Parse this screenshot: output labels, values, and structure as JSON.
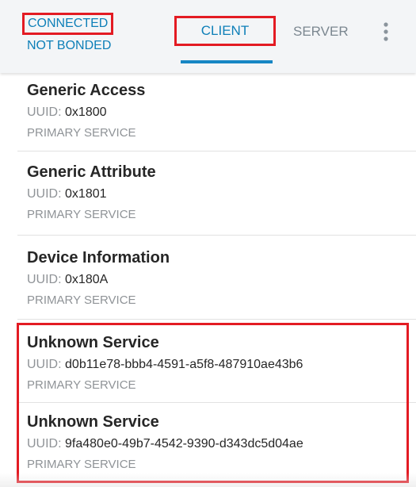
{
  "header": {
    "connection_status": "CONNECTED",
    "bond_status": "NOT BONDED",
    "tabs": [
      {
        "label": "CLIENT",
        "active": true
      },
      {
        "label": "SERVER",
        "active": false
      }
    ],
    "menu_icon": "overflow-vertical-dots-icon"
  },
  "services": [
    {
      "name": "Generic Access",
      "uuid_label": "UUID:",
      "uuid": "0x1800",
      "type": "PRIMARY SERVICE"
    },
    {
      "name": "Generic Attribute",
      "uuid_label": "UUID:",
      "uuid": "0x1801",
      "type": "PRIMARY SERVICE"
    },
    {
      "name": "Device Information",
      "uuid_label": "UUID:",
      "uuid": "0x180A",
      "type": "PRIMARY SERVICE"
    },
    {
      "name": "Unknown Service",
      "uuid_label": "UUID:",
      "uuid": "d0b11e78-bbb4-4591-a5f8-487910ae43b6",
      "type": "PRIMARY SERVICE"
    },
    {
      "name": "Unknown Service",
      "uuid_label": "UUID:",
      "uuid": "9fa480e0-49b7-4542-9390-d343dc5d04ae",
      "type": "PRIMARY SERVICE"
    }
  ],
  "colors": {
    "accent": "#0d7fb8",
    "highlight": "#e31b23",
    "muted": "#8f9397"
  }
}
